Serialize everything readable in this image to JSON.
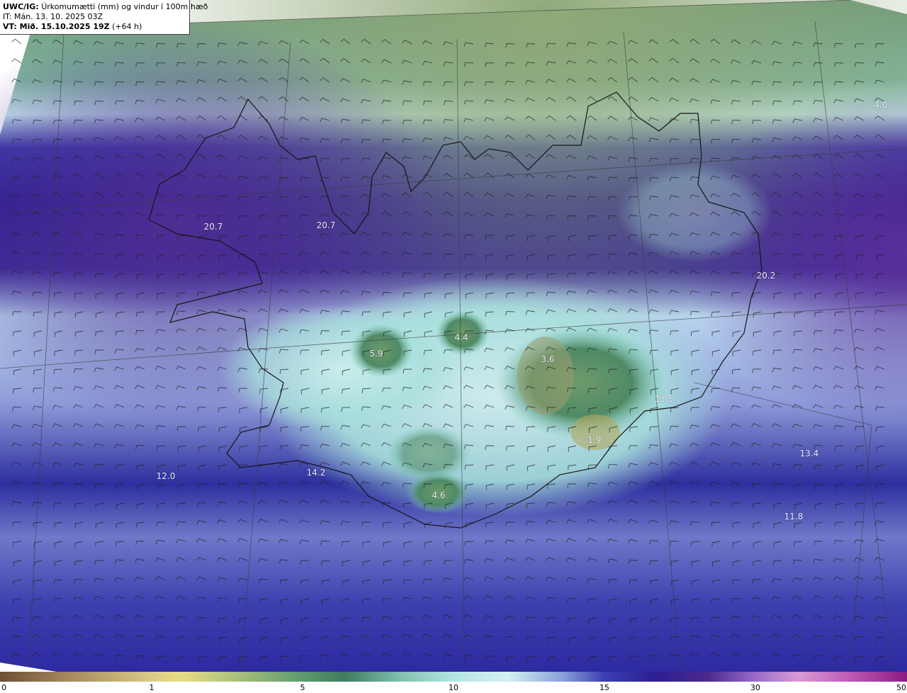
{
  "header": {
    "model": "UWC/IG:",
    "title": "Úrkomumætti (mm) og vindur í 100m hæð",
    "initial_time": "IT: Mán. 13. 10. 2025 03Z",
    "valid_prefix": "VT: Mið. 15.10.2025 19Z",
    "valid_lead": "(+64 h)"
  },
  "map_labels": [
    {
      "id": "label-nw-sea",
      "text": "20.7"
    },
    {
      "id": "label-westfjords",
      "text": "20.7"
    },
    {
      "id": "label-east",
      "text": "20.2"
    },
    {
      "id": "label-north-sea",
      "text": "4.0"
    },
    {
      "id": "label-langjokull",
      "text": "5.9"
    },
    {
      "id": "label-hofsjokull",
      "text": "4.4"
    },
    {
      "id": "label-vatnajokull",
      "text": "3.6"
    },
    {
      "id": "label-southeast-coast",
      "text": "13.5"
    },
    {
      "id": "label-oraefajokull",
      "text": "1.9"
    },
    {
      "id": "label-east-sea",
      "text": "13.4"
    },
    {
      "id": "label-southwest-sea",
      "text": "12.0"
    },
    {
      "id": "label-reykjanes",
      "text": "14.2"
    },
    {
      "id": "label-myrdalsjokull",
      "text": "4.6"
    },
    {
      "id": "label-southeast-sea",
      "text": "11.8"
    }
  ],
  "colorbar": {
    "unit": "mm",
    "ticks": [
      "0",
      "1",
      "5",
      "10",
      "15",
      "30",
      "50"
    ],
    "colors": {
      "dry": "#6e4f33",
      "low": "#d9cb88",
      "mid_green": "#3f7a60",
      "light_cyan": "#b4e6e2",
      "blue": "#3a3db0",
      "indigo": "#2d1f95",
      "violet": "#9a6bc8",
      "magenta": "#8c1c82"
    }
  }
}
